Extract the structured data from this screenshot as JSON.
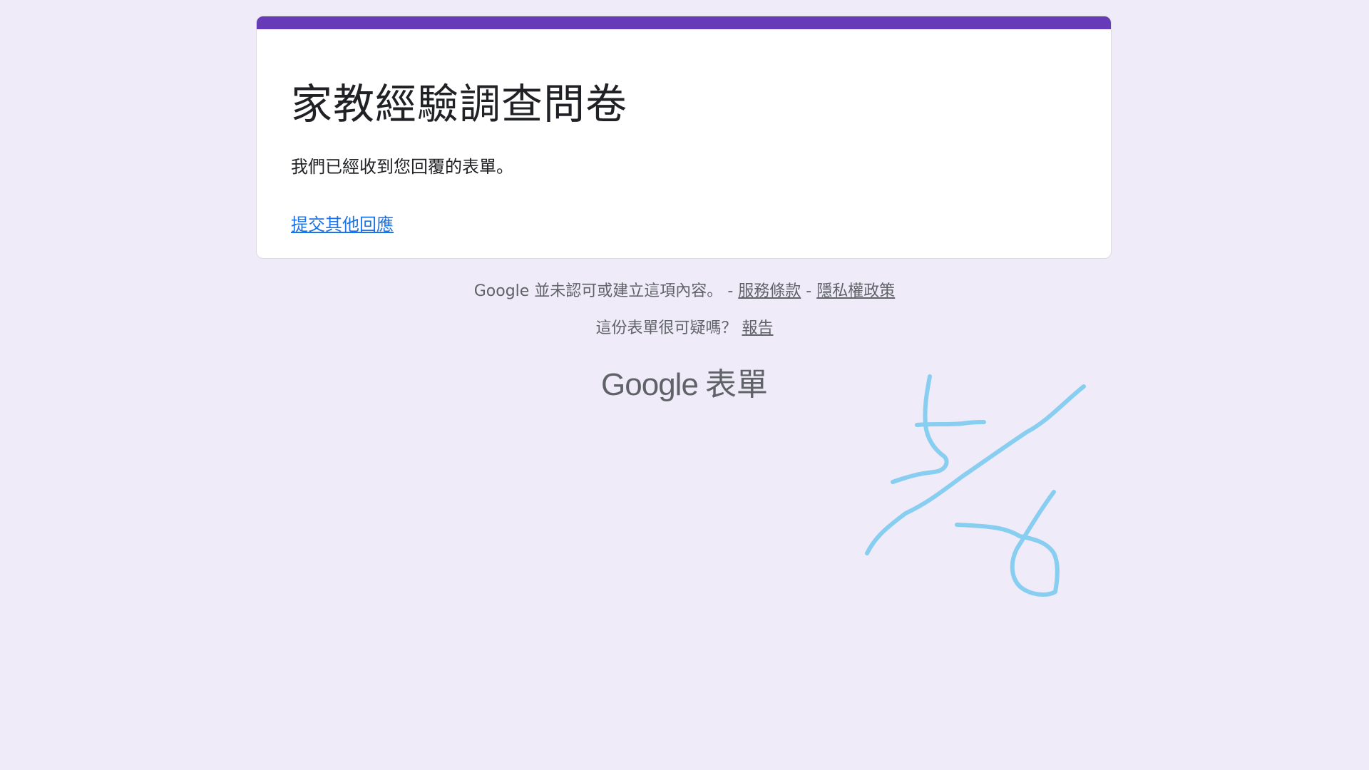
{
  "form": {
    "title": "家教經驗調查問卷",
    "confirmation_message": "我們已經收到您回覆的表單。",
    "submit_another_link": "提交其他回應"
  },
  "footer": {
    "disclaimer": "Google 並未認可或建立這項內容。",
    "separator": "-",
    "terms_link": "服務條款",
    "privacy_link": "隱私權政策",
    "suspicious_question": "這份表單很可疑嗎？",
    "report_link": "報告"
  },
  "branding": {
    "google": "Google",
    "product": "表單"
  },
  "colors": {
    "background": "#f0ebf8",
    "accent": "#673ab7",
    "link": "#1a73e8",
    "annotation": "#87cef0"
  }
}
